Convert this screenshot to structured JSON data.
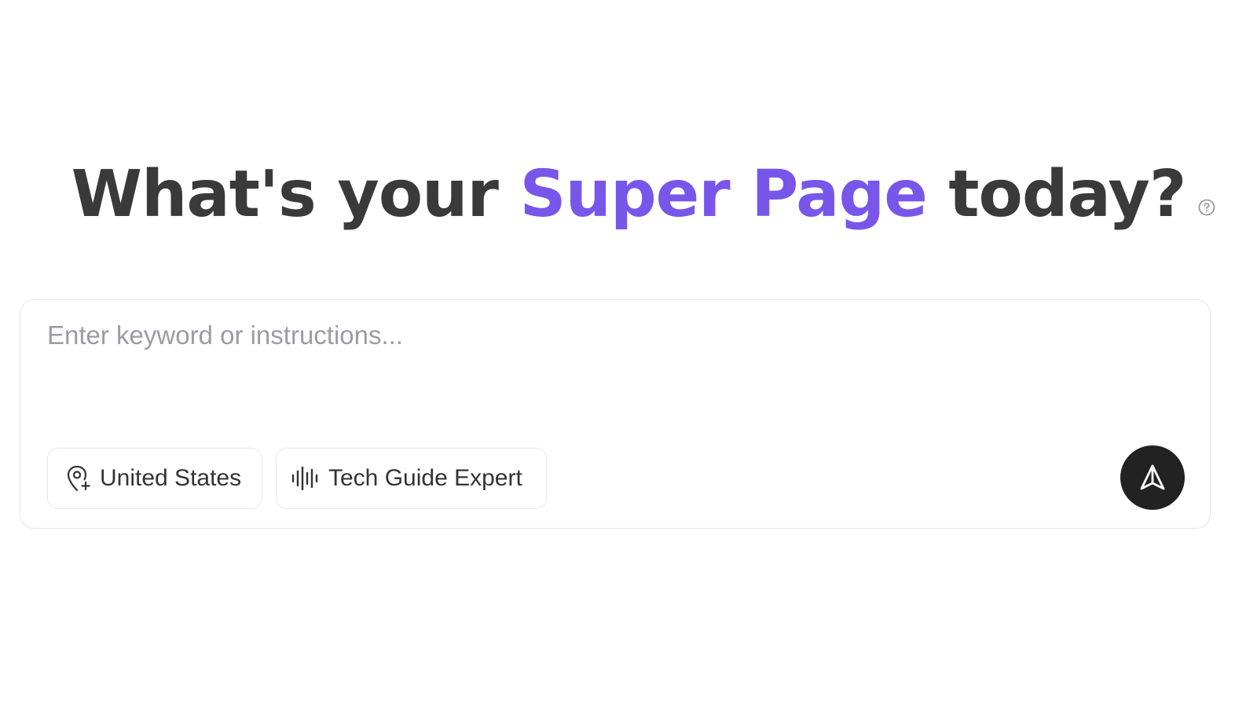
{
  "hero": {
    "title_prefix": "What's your ",
    "title_highlight": "Super Page",
    "title_suffix": " today?",
    "help_icon": "question-circle-icon",
    "accent_color": "#7856ea",
    "text_color": "#3a3a3a"
  },
  "composer": {
    "input_value": "",
    "placeholder": "Enter keyword or instructions...",
    "chips": {
      "location": {
        "label": "United States",
        "icon": "location-pin-plus-icon"
      },
      "voice": {
        "label": "Tech Guide Expert",
        "icon": "audio-waveform-icon"
      }
    },
    "send_button": {
      "icon": "send-arrow-icon",
      "color": "#222222"
    }
  }
}
